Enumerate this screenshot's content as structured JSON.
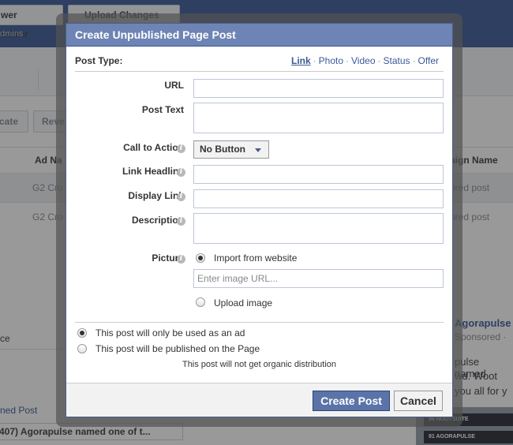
{
  "background": {
    "top_buttons": [
      "wer Editor",
      "Upload Changes"
    ],
    "admins_text": "dmins",
    "action_buttons": [
      "cate",
      "Reve"
    ],
    "table_headers": [
      "Ad Na",
      "aign Name"
    ],
    "rows": [
      {
        "ad": "G2 Cro",
        "campaign": "ored post"
      },
      {
        "ad": "G2 Cro",
        "campaign": "ored post"
      }
    ],
    "lower_left_label": "ce",
    "named_post_link": "ned Post",
    "selected_post": "407) Agorapulse named one of t...",
    "right_title": "Agorapulse",
    "right_sponsored": "Sponsored ·",
    "right_text_lines": [
      "pulse named",
      "wd. Woot",
      "you all for y"
    ],
    "thumb_rows": [
      "96 HOOTSUITE",
      "91 AGORAPULSE"
    ]
  },
  "dialog": {
    "title": "Create Unpublished Page Post",
    "post_type_label": "Post Type:",
    "post_types": [
      {
        "label": "Link",
        "active": true
      },
      {
        "label": "Photo",
        "active": false
      },
      {
        "label": "Video",
        "active": false
      },
      {
        "label": "Status",
        "active": false
      },
      {
        "label": "Offer",
        "active": false
      }
    ],
    "fields": {
      "url_label": "URL",
      "url_value": "",
      "post_text_label": "Post Text",
      "post_text_value": "",
      "cta_label": "Call to Action",
      "cta_value": "No Button",
      "headline_label": "Link Headline",
      "headline_value": "",
      "display_link_label": "Display Link",
      "display_link_value": "",
      "description_label": "Description",
      "description_value": "",
      "picture_label": "Picture",
      "import_label": "Import from website",
      "image_url_placeholder": "Enter image URL...",
      "upload_label": "Upload image"
    },
    "usage": {
      "ad_only_label": "This post will only be used as an ad",
      "publish_label": "This post will be published on the Page",
      "note": "This post will not get organic distribution",
      "selected": "ad_only"
    },
    "buttons": {
      "create": "Create Post",
      "cancel": "Cancel"
    }
  },
  "colors": {
    "dialog_header": "#6d84b4",
    "primary_button": "#5b74a8",
    "link": "#3b5998"
  }
}
